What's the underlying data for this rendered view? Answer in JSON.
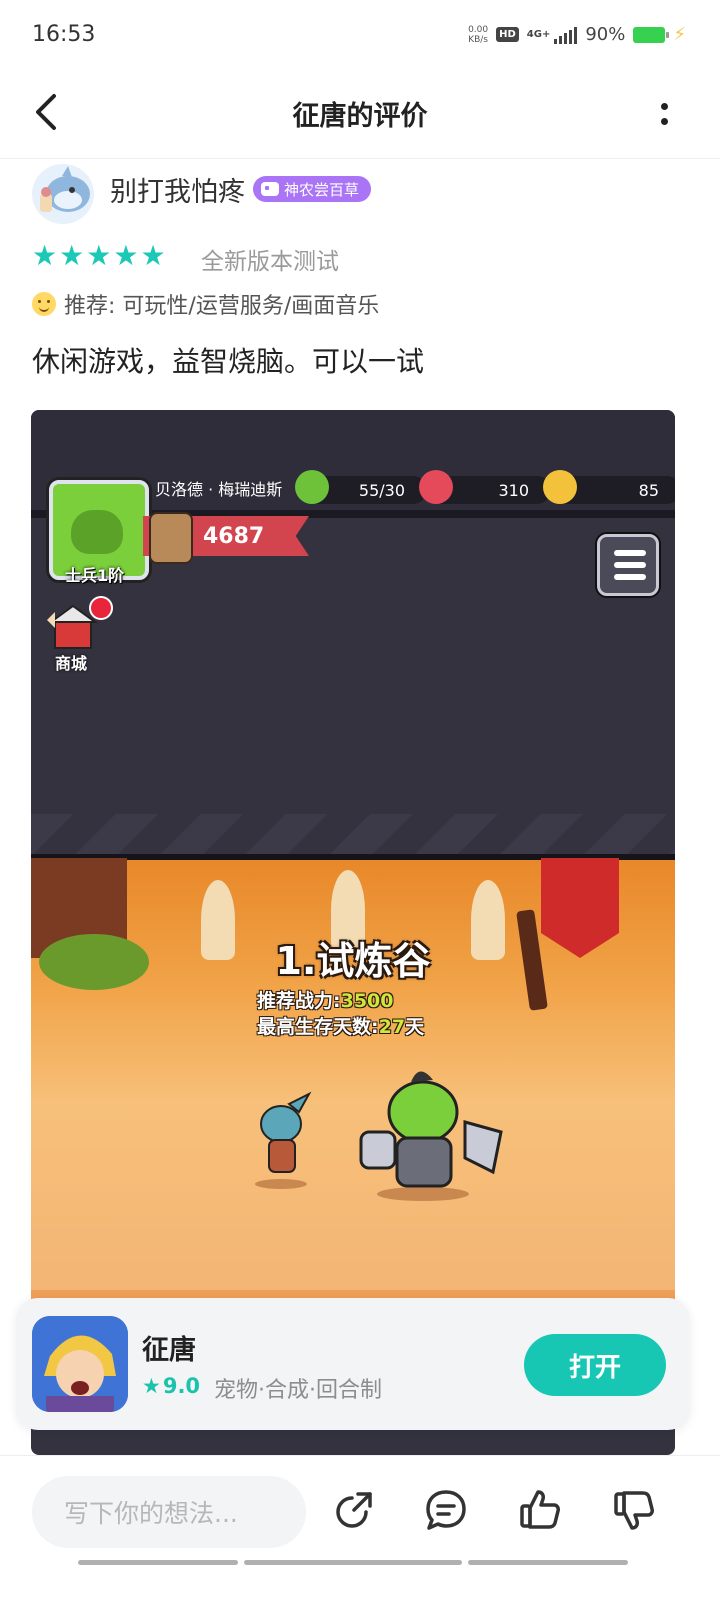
{
  "status_bar": {
    "time": "16:53",
    "net_speed_value": "0.00",
    "net_speed_unit": "KB/s",
    "hd": "HD",
    "network": "4G+",
    "battery": "90%"
  },
  "header": {
    "title": "征唐的评价"
  },
  "review": {
    "username": "别打我怕疼",
    "badge": "神农尝百草",
    "stars": 5,
    "rating_tag": "全新版本测试",
    "recommend": "推荐: 可玩性/运营服务/画面音乐",
    "text": "休闲游戏，益智烧脑。可以一试"
  },
  "game_screenshot": {
    "player_name": "贝洛德 · 梅瑞迪斯",
    "rank": "士兵1阶",
    "energy": "55/30",
    "gems": "310",
    "coins": "85",
    "power": "4687",
    "shop_label": "商城",
    "stage_title": "1.试炼谷",
    "recommended_power_label": "推荐战力:",
    "recommended_power_value": "3500",
    "max_days_label": "最高生存天数:",
    "max_days_value": "27",
    "max_days_unit": "天"
  },
  "app_card": {
    "name": "征唐",
    "score": "9.0",
    "tags": "宠物·合成·回合制",
    "open_button": "打开"
  },
  "bottom_bar": {
    "comment_placeholder": "写下你的想法..."
  },
  "colors": {
    "accent": "#17c7b4",
    "badge": "#a974f5",
    "star": "#1cc9b6"
  }
}
